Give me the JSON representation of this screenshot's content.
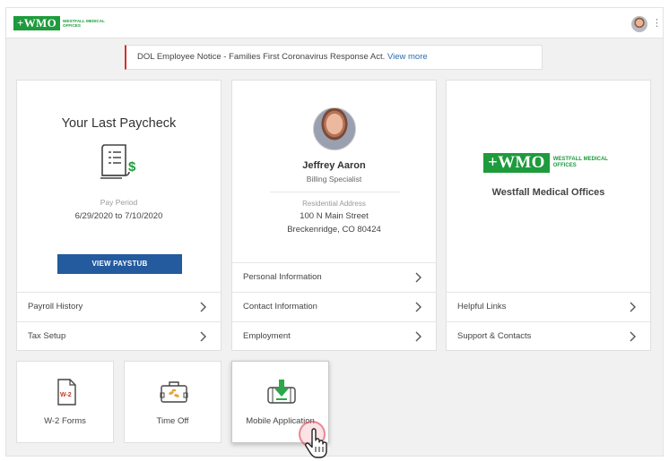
{
  "header": {
    "logo_text": "+WMO",
    "logo_subtitle": "WESTFALL MEDICAL OFFICES",
    "kebab": "⋮"
  },
  "notice": {
    "text": "DOL Employee Notice - Families First Coronavirus Response Act. ",
    "link": "View more"
  },
  "paycheck": {
    "title": "Your Last Paycheck",
    "period_label": "Pay Period",
    "period_value": "6/29/2020 to 7/10/2020",
    "button": "VIEW PAYSTUB",
    "links": [
      "Payroll History",
      "Tax Setup"
    ]
  },
  "employee": {
    "name": "Jeffrey Aaron",
    "title": "Billing Specialist",
    "address_label": "Residential Address",
    "address_line1": "100 N Main Street",
    "address_line2": "Breckenridge, CO 80424",
    "links": [
      "Personal Information",
      "Contact Information",
      "Employment"
    ]
  },
  "company": {
    "logo_text": "+WMO",
    "logo_subtitle": "WESTFALL MEDICAL OFFICES",
    "name": "Westfall Medical Offices",
    "links": [
      "Helpful Links",
      "Support & Contacts"
    ]
  },
  "tiles": [
    {
      "label": "W-2 Forms",
      "icon": "w2-document-icon",
      "icon_text": "W-2"
    },
    {
      "label": "Time Off",
      "icon": "suitcase-icon"
    },
    {
      "label": "Mobile Application",
      "icon": "mobile-download-icon"
    }
  ],
  "colors": {
    "brand_green": "#1e9b3c",
    "primary_blue": "#245a9e",
    "notice_red": "#d32f2f",
    "link_blue": "#2b6cb0"
  }
}
